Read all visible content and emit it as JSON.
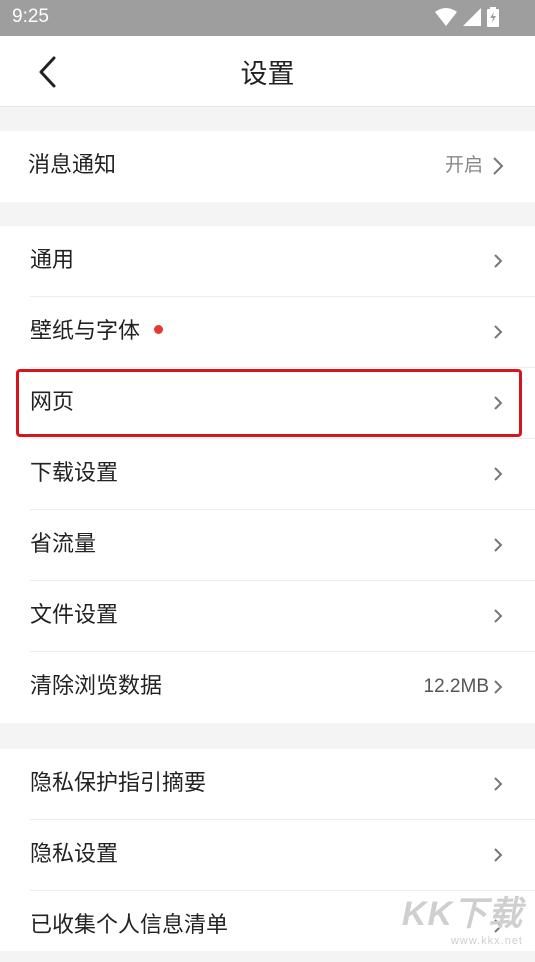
{
  "status": {
    "time": "9:25"
  },
  "header": {
    "title": "设置"
  },
  "notification": {
    "label": "消息通知",
    "value": "开启"
  },
  "general": [
    {
      "label": "通用"
    },
    {
      "label": "壁纸与字体"
    },
    {
      "label": "网页"
    },
    {
      "label": "下载设置"
    },
    {
      "label": "省流量"
    },
    {
      "label": "文件设置"
    },
    {
      "label": "清除浏览数据",
      "value": "12.2MB"
    }
  ],
  "privacy": [
    {
      "label": "隐私保护指引摘要"
    },
    {
      "label": "隐私设置"
    },
    {
      "label": "已收集个人信息清单"
    }
  ],
  "watermark": {
    "big": "KK下载",
    "small": "www.kkx.net"
  },
  "colors": {
    "accent_red": "#d9141c",
    "dot_red": "#e53935",
    "statusbar": "#9e9e9e"
  }
}
